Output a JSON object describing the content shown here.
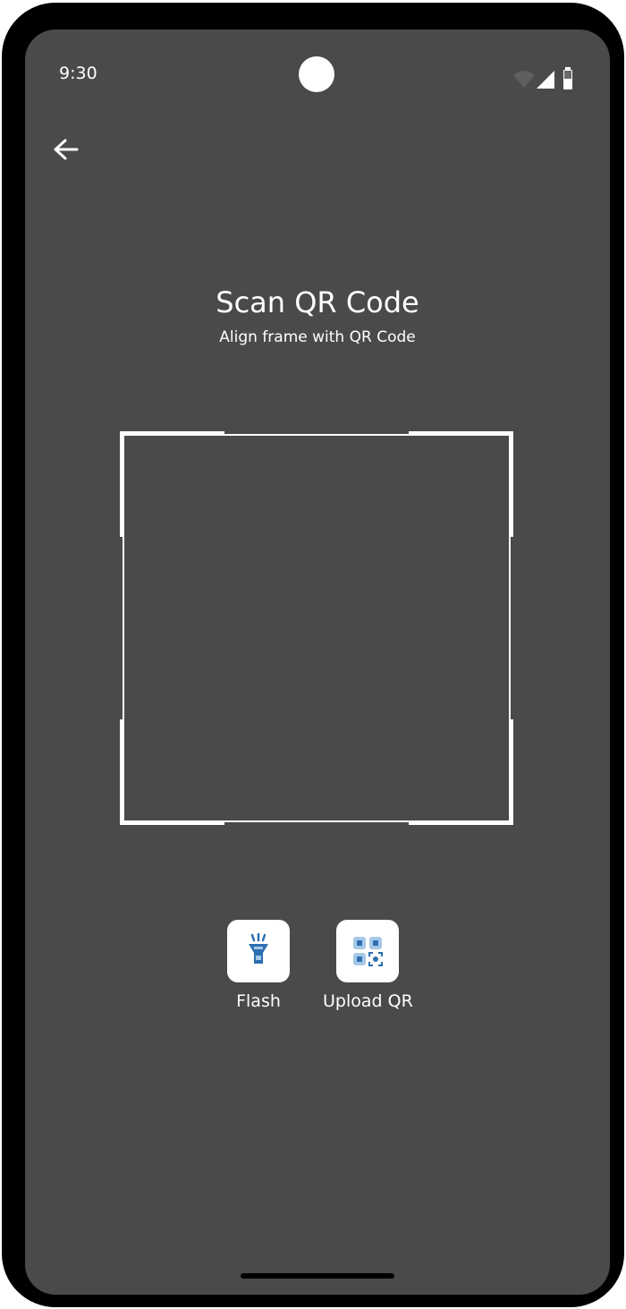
{
  "status_bar": {
    "time": "9:30",
    "icons": [
      "wifi-icon",
      "signal-icon",
      "battery-icon"
    ]
  },
  "header": {
    "back_icon": "arrow-left-icon"
  },
  "main": {
    "title": "Scan  QR Code",
    "subtitle": "Align frame with QR Code"
  },
  "actions": [
    {
      "label": "Flash",
      "icon": "flashlight-icon"
    },
    {
      "label": "Upload QR",
      "icon": "qr-upload-icon"
    }
  ],
  "colors": {
    "screen_background": "#4a4a4a",
    "frame": "#ffffff",
    "icon_blue": "#2c6fb0"
  }
}
